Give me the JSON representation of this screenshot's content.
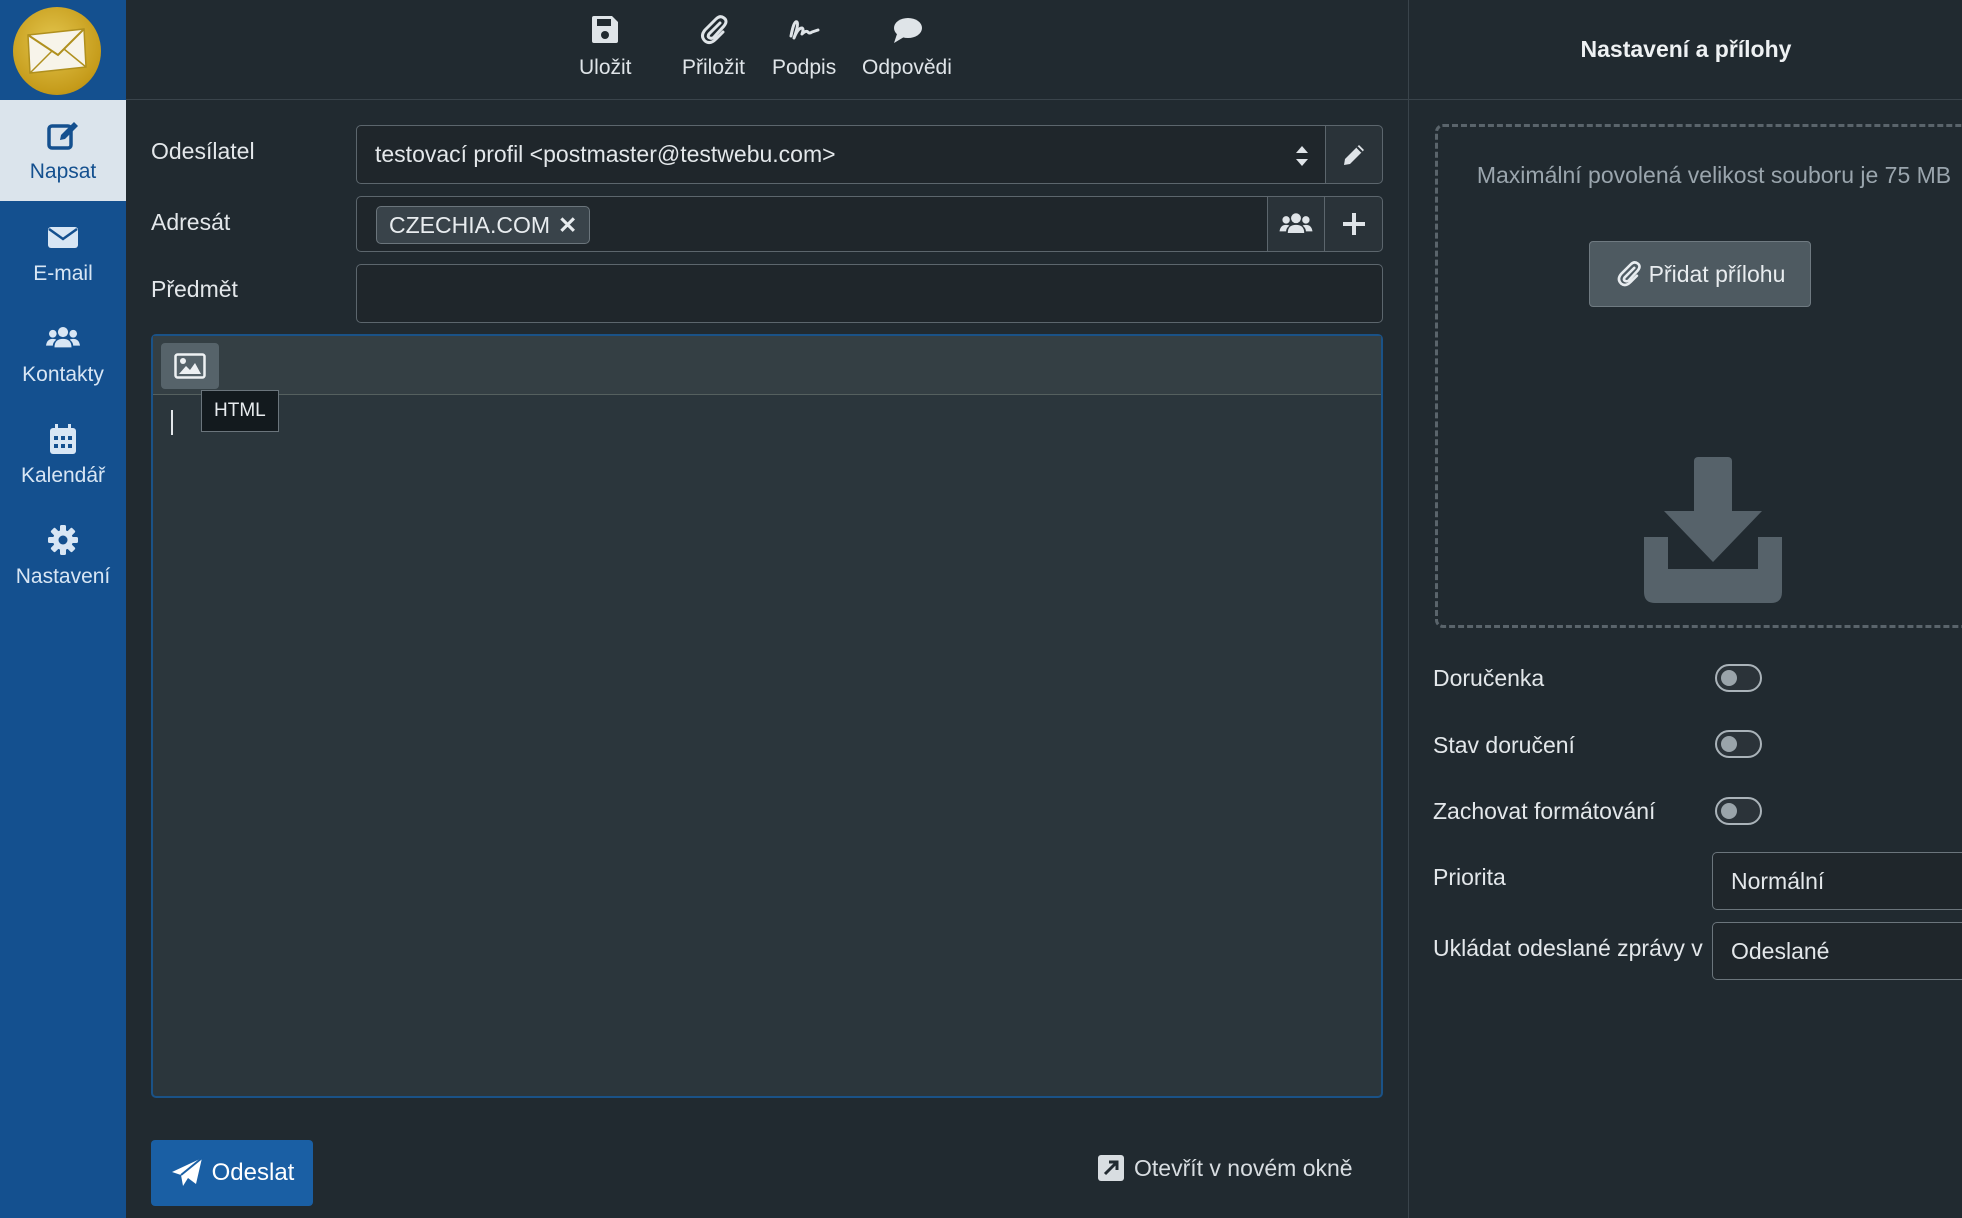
{
  "nav": {
    "items": [
      {
        "label": "Napsat",
        "icon": "edit-icon",
        "active": true
      },
      {
        "label": "E-mail",
        "icon": "envelope-icon",
        "active": false
      },
      {
        "label": "Kontakty",
        "icon": "users-icon",
        "active": false
      },
      {
        "label": "Kalendář",
        "icon": "calendar-icon",
        "active": false
      },
      {
        "label": "Nastavení",
        "icon": "gear-icon",
        "active": false
      }
    ]
  },
  "toolbar": {
    "save_label": "Uložit",
    "attach_label": "Přiložit",
    "signature_label": "Podpis",
    "responses_label": "Odpovědi"
  },
  "compose": {
    "from_label": "Odesílatel",
    "from_value": "testovací profil <postmaster@testwebu.com>",
    "to_label": "Adresát",
    "to_recipient": "CZECHIA.COM",
    "subject_label": "Předmět",
    "subject_value": "",
    "editor_tooltip": "HTML",
    "send_label": "Odeslat",
    "open_new_window_label": "Otevřít v novém okně"
  },
  "settings_panel": {
    "title": "Nastavení a přílohy",
    "max_size_text": "Maximální povolená velikost souboru je 75 MB",
    "add_attachment_label": "Přidat přílohu",
    "options": {
      "receipt_label": "Doručenka",
      "receipt_on": false,
      "dsn_label": "Stav doručení",
      "dsn_on": false,
      "keep_format_label": "Zachovat formátování",
      "keep_format_on": false,
      "priority_label": "Priorita",
      "priority_value": "Normální",
      "save_sent_label": "Ukládat odeslané zprávy v",
      "save_sent_value": "Odeslané"
    }
  },
  "colors": {
    "nav_bg": "#14508f",
    "accent": "#1a5fa4",
    "page_bg": "#212a30"
  }
}
